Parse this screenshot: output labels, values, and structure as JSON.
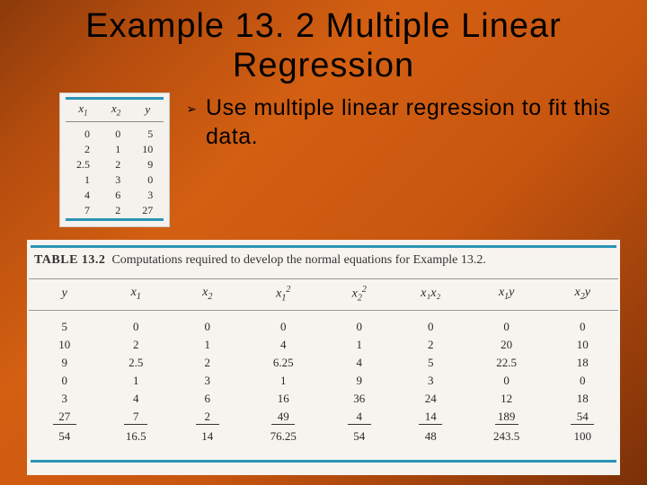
{
  "title": "Example 13. 2 Multiple Linear Regression",
  "bullet": {
    "marker": "➢",
    "text": "Use multiple linear regression to fit this data."
  },
  "small_table": {
    "headers": {
      "c0": "x",
      "c0s": "1",
      "c1": "x",
      "c1s": "2",
      "c2": "y"
    },
    "rows": [
      {
        "x1": "0",
        "x2": "0",
        "y": "5"
      },
      {
        "x1": "2",
        "x2": "1",
        "y": "10"
      },
      {
        "x1": "2.5",
        "x2": "2",
        "y": "9"
      },
      {
        "x1": "1",
        "x2": "3",
        "y": "0"
      },
      {
        "x1": "4",
        "x2": "6",
        "y": "3"
      },
      {
        "x1": "7",
        "x2": "2",
        "y": "27"
      }
    ]
  },
  "big_table": {
    "label": "TABLE 13.2",
    "caption": "Computations required to develop the normal equations for Example 13.2.",
    "headers": {
      "y": "y",
      "x1": "x",
      "x1s": "1",
      "x2": "x",
      "x2s": "2",
      "x1sq": "x",
      "x1sqs": "1",
      "x1sqe": "2",
      "x2sq": "x",
      "x2sqs": "2",
      "x2sqe": "2",
      "x1x2": "x₁x₂",
      "x1y_a": "x",
      "x1y_as": "1",
      "x1y_b": "y",
      "x2y_a": "x",
      "x2y_as": "2",
      "x2y_b": "y"
    },
    "rows": [
      {
        "y": "5",
        "x1": "0",
        "x2": "0",
        "x1sq": "0",
        "x2sq": "0",
        "x1x2": "0",
        "x1y": "0",
        "x2y": "0"
      },
      {
        "y": "10",
        "x1": "2",
        "x2": "1",
        "x1sq": "4",
        "x2sq": "1",
        "x1x2": "2",
        "x1y": "20",
        "x2y": "10"
      },
      {
        "y": "9",
        "x1": "2.5",
        "x2": "2",
        "x1sq": "6.25",
        "x2sq": "4",
        "x1x2": "5",
        "x1y": "22.5",
        "x2y": "18"
      },
      {
        "y": "0",
        "x1": "1",
        "x2": "3",
        "x1sq": "1",
        "x2sq": "9",
        "x1x2": "3",
        "x1y": "0",
        "x2y": "0"
      },
      {
        "y": "3",
        "x1": "4",
        "x2": "6",
        "x1sq": "16",
        "x2sq": "36",
        "x1x2": "24",
        "x1y": "12",
        "x2y": "18"
      },
      {
        "y": "27",
        "x1": "7",
        "x2": "2",
        "x1sq": "49",
        "x2sq": "4",
        "x1x2": "14",
        "x1y": "189",
        "x2y": "54"
      }
    ],
    "sums": {
      "y": "54",
      "x1": "16.5",
      "x2": "14",
      "x1sq": "76.25",
      "x2sq": "54",
      "x1x2": "48",
      "x1y": "243.5",
      "x2y": "100"
    }
  }
}
